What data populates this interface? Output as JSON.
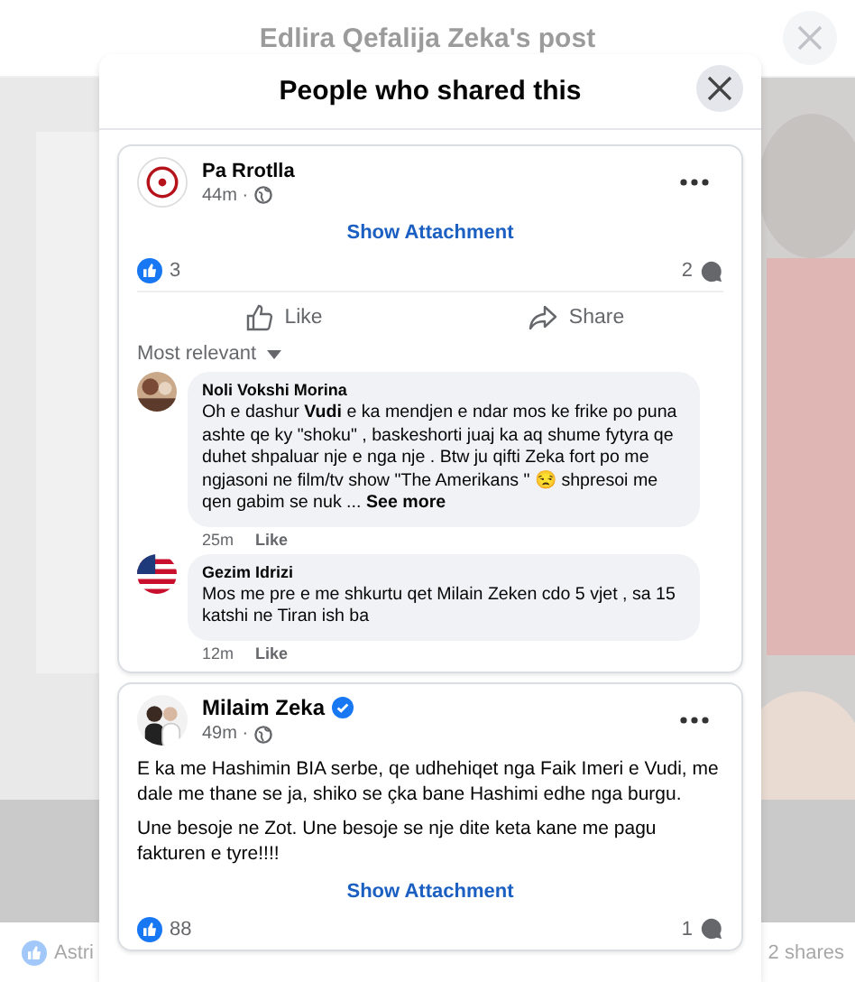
{
  "background": {
    "title": "Edlira Qefalija Zeka's post",
    "footer_left": "Astri",
    "footer_right": "2 shares"
  },
  "modal": {
    "title": "People who shared this",
    "posts": [
      {
        "author": "Pa Rrotlla",
        "verified": false,
        "avatar": {
          "kind": "logo"
        },
        "time": "44m ·",
        "attachment": "Show Attachment",
        "likes": "3",
        "comments_count": "2",
        "actions": [
          "Like",
          "Share"
        ],
        "sort_label": "Most relevant",
        "comments": [
          {
            "author": "Noli Vokshi Morina",
            "text": "Oh e dashur **Vudi** e ka mendjen e ndar mos ke frike po puna ashte qe ky \"shoku\" , baskeshorti juaj ka aq shume fytyra qe duhet shpaluar nje e nga nje . Btw ju qifti Zeka fort po me ngjasoni ne film/tv show \"The Amerikans \" 😒 shpresoi me qen gabim se nuk ...",
            "more": "See more",
            "time": "25m",
            "action": "Like"
          },
          {
            "author": "Gezim Idrizi",
            "avatar": {
              "kind": "flag"
            },
            "text": "Mos me pre e me shkurtu qet Milain Zeken cdo 5 vjet , sa 15 katshi ne Tiran ish ba",
            "time": "12m",
            "action": "Like"
          }
        ]
      },
      {
        "author": "Milaim Zeka",
        "verified": true,
        "time": "49m ·",
        "paragraphs": [
          "E ka me Hashimin BIA serbe, qe udhehiqet nga Faik Imeri e Vudi, me dale me thane se ja, shiko se çka bane Hashimi edhe nga burgu.",
          "Une besoje ne Zot. Une besoje se nje dite keta kane me pagu fakturen e tyre!!!!"
        ],
        "attachment": "Show Attachment",
        "likes": "88",
        "comments_count": "1"
      }
    ]
  }
}
